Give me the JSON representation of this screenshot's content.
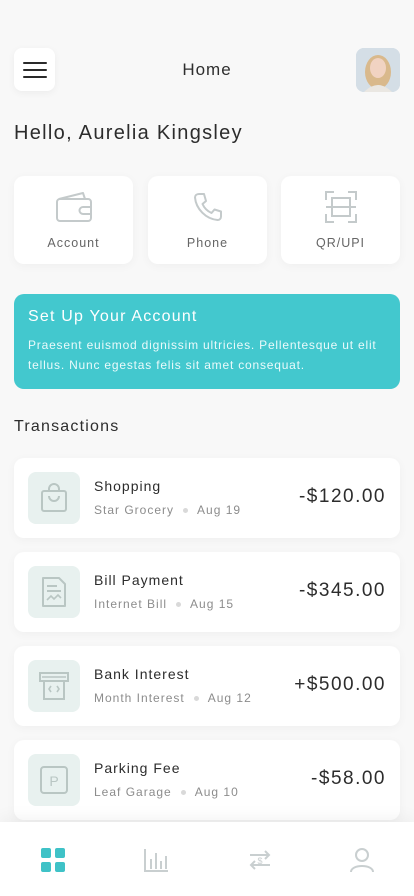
{
  "header": {
    "title": "Home",
    "menu_icon": "hamburger-menu-icon",
    "avatar": "user-avatar"
  },
  "greeting": "Hello, Aurelia Kingsley",
  "quick_actions": [
    {
      "label": "Account",
      "icon": "wallet-icon"
    },
    {
      "label": "Phone",
      "icon": "phone-icon"
    },
    {
      "label": "QR/UPI",
      "icon": "qr-scan-icon"
    }
  ],
  "banner": {
    "title": "Set Up Your Account",
    "text": "Praesent euismod dignissim ultricies. Pellentesque ut elit tellus. Nunc egestas felis sit amet consequat.",
    "color": "#43c8ce"
  },
  "transactions_title": "Transactions",
  "transactions": [
    {
      "title": "Shopping",
      "subtitle": "Star Grocery",
      "date": "Aug 19",
      "amount": "-$120.00",
      "icon": "shopping-bag-icon"
    },
    {
      "title": "Bill Payment",
      "subtitle": "Internet Bill",
      "date": "Aug 15",
      "amount": "-$345.00",
      "icon": "bill-icon"
    },
    {
      "title": "Bank Interest",
      "subtitle": "Month Interest",
      "date": "Aug 12",
      "amount": "+$500.00",
      "icon": "bank-icon"
    },
    {
      "title": "Parking Fee",
      "subtitle": "Leaf Garage",
      "date": "Aug 10",
      "amount": "-$58.00",
      "icon": "parking-icon"
    }
  ],
  "bottom_nav": [
    {
      "icon": "dashboard-icon",
      "active": true
    },
    {
      "icon": "chart-icon",
      "active": false
    },
    {
      "icon": "transfer-icon",
      "active": false
    },
    {
      "icon": "profile-icon",
      "active": false
    }
  ],
  "colors": {
    "accent": "#43c8ce",
    "icon_muted": "#c9cfd0",
    "nav_active": "#3fc2c7"
  }
}
